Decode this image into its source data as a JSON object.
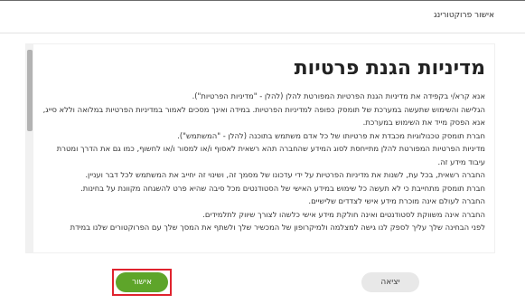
{
  "dialog": {
    "title": "אישור פרוקטורינג"
  },
  "policy": {
    "heading": "מדיניות הגנת פרטיות",
    "paragraphs": [
      "אנא קרא/י בקפידה את מדיניות הגנת הפרטיות המפורטת להלן (להלן - \"מדיניות הפרטיות\").",
      "הגלישה והשימוש שתעשה במערכת של תומסק כפופה למדיניות הפרטיות. במידה ואינך מסכים לאמור במדיניות הפרטיות במלואה וללא סייג, אנא הפסק מייד את השימוש במערכת.",
      "חברת תומסק טכנולוגיות מכבדת את פרטיותו של כל אדם משתמש בתוכנה (להלן - \"המשתמש\").",
      "מדיניות הפרטיות המפורטת להלן מתייחסת לסוג המידע שהחברה תהא רשאית לאסוף ו/או למסור ו/או לחשוף, כמו גם את הדרך ומטרת עיבוד מידע זה.",
      "החברה רשאית, בכל עת, לשנות את מדיניות הפרטיות על ידי עדכונו של מסמך זה, ושינוי זה יחייב את המשתמש לכל דבר ועניין.",
      "חברת תומסק מתחייבת כי לא תעשה כל שימוש במידע האישי של הסטודנטים מכל סיבה שהיא פרט להשגחה מקוונת על בחינות.",
      "החברה לעולם אינה מוכרת מידע אישי לצדדים שלישיים.",
      "החברה אינה משווקת לסטודנטים ואינה חולקת מידע אישי כלשהו לצורך שיווק לתלמידים.",
      "לפני הבחינה שלך עליך לספק לנו גישה למצלמה ולמיקרופון של המכשיר שלך ולשתף את המסך שלך עם הפרוקטורים שלנו במידת"
    ]
  },
  "footer": {
    "confirm_label": "אישור",
    "exit_label": "יציאה"
  }
}
